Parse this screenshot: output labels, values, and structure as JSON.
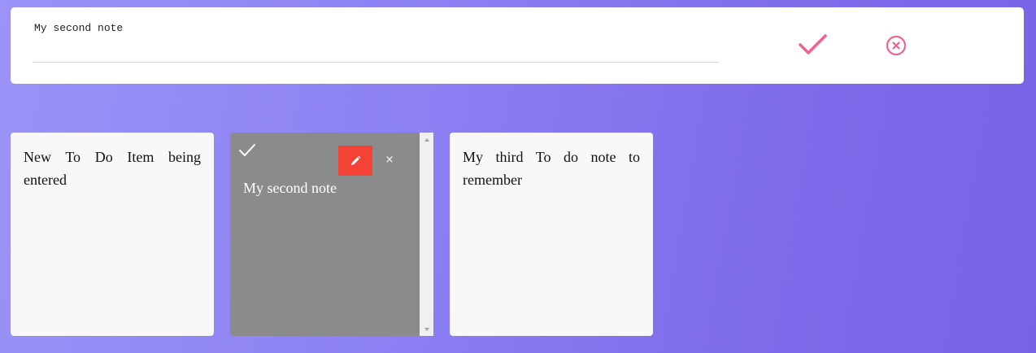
{
  "editor": {
    "input_value": "My second note",
    "confirm_icon": "check-icon",
    "cancel_icon": "close-circle-icon",
    "accent_color": "#f06292"
  },
  "notes": [
    {
      "text": "New To Do Item being entered",
      "state": "normal"
    },
    {
      "text": "My second note",
      "state": "selected",
      "actions": [
        "done-icon",
        "edit-icon",
        "delete-icon"
      ]
    },
    {
      "text": "My third To do note to remember",
      "state": "normal"
    }
  ],
  "colors": {
    "note_bg": "#f8f8f8",
    "selected_note_bg": "#8b8b8b",
    "edit_button": "#f44336",
    "gradient_start": "#9b93f7",
    "gradient_end": "#7763e6"
  },
  "delete_glyph": "×"
}
